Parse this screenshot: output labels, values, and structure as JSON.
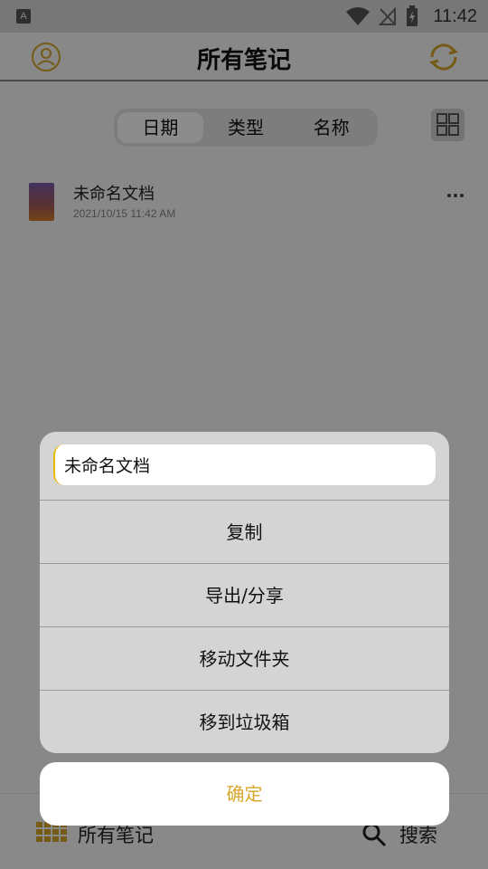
{
  "status_bar": {
    "app_badge": "A",
    "time": "11:42"
  },
  "header": {
    "title": "所有笔记"
  },
  "tabs": [
    {
      "label": "日期"
    },
    {
      "label": "类型"
    },
    {
      "label": "名称"
    }
  ],
  "notes": [
    {
      "title": "未命名文档",
      "date": "2021/10/15 11:42 AM"
    }
  ],
  "bottom_nav": {
    "all_notes_label": "所有笔记",
    "search_label": "搜索"
  },
  "dialog": {
    "name_value": "未命名文档",
    "items": [
      {
        "label": "复制"
      },
      {
        "label": "导出/分享"
      },
      {
        "label": "移动文件夹"
      },
      {
        "label": "移到垃圾箱"
      }
    ],
    "confirm_label": "确定"
  },
  "colors": {
    "accent": "#d8a72a",
    "overlay": "#000000"
  }
}
